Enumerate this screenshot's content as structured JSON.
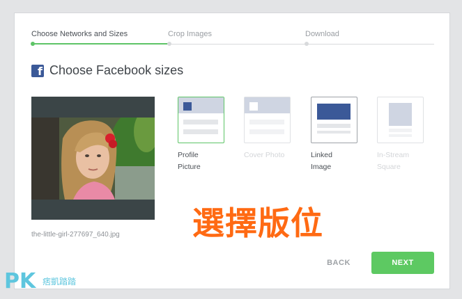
{
  "steps": [
    {
      "label": "Choose Networks and Sizes"
    },
    {
      "label": "Crop Images"
    },
    {
      "label": "Download"
    }
  ],
  "heading": {
    "icon": "facebook-icon",
    "title": "Choose Facebook sizes"
  },
  "image": {
    "filename": "the-little-girl-277697_640.jpg"
  },
  "options": [
    {
      "line1": "Profile",
      "line2": "Picture"
    },
    {
      "line1": "Cover Photo",
      "line2": ""
    },
    {
      "line1": "Linked",
      "line2": "Image"
    },
    {
      "line1": "In-Stream",
      "line2": "Square"
    }
  ],
  "buttons": {
    "back": "BACK",
    "next": "NEXT"
  },
  "overlay": {
    "text": "選擇版位"
  },
  "watermark": {
    "logo": "PK",
    "sub": "痞凱踏踏"
  },
  "colors": {
    "accent": "#5dc466",
    "facebook": "#3b5998",
    "overlay": "#ff6a13"
  }
}
